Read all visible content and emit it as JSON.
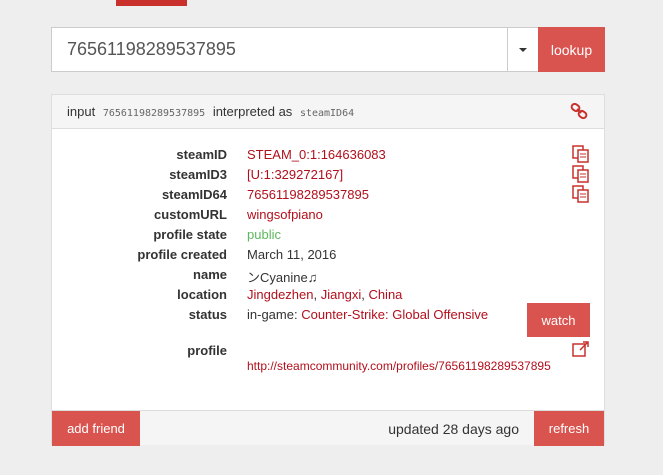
{
  "search": {
    "value": "76561198289537895",
    "lookup_label": "lookup"
  },
  "heading": {
    "prefix": "input",
    "input_value": "76561198289537895",
    "middle": "interpreted as",
    "interpreted_as": "steamID64"
  },
  "rows": [
    {
      "label": "steamID",
      "value": "STEAM_0:1:164636083"
    },
    {
      "label": "steamID3",
      "value": "[U:1:329272167]"
    },
    {
      "label": "steamID64",
      "value": "76561198289537895"
    },
    {
      "label": "customURL",
      "value": "wingsofpiano"
    },
    {
      "label": "profile state",
      "value": "public"
    },
    {
      "label": "profile created",
      "value": "March 11, 2016"
    },
    {
      "label": "name",
      "value": "ンCyanine♫"
    },
    {
      "label": "location",
      "city": "Jingdezhen",
      "region": "Jiangxi",
      "country": "China"
    },
    {
      "label": "status",
      "prefix": "in-game:",
      "game": "Counter-Strike: Global Offensive"
    },
    {
      "label": "profile",
      "url": "http://steamcommunity.com/profiles/76561198289537895"
    }
  ],
  "watch_label": "watch",
  "footer": {
    "add_friend_label": "add friend",
    "updated_text": "updated 28 days ago",
    "refresh_label": "refresh"
  },
  "colors": {
    "accent": "#d9534f",
    "link": "#b20f1c",
    "public": "#5cb85c"
  },
  "icons": {
    "dropdown": "caret-down-icon",
    "heading_link": "link-icon",
    "copy": "copy-icon",
    "external": "external-link-icon"
  }
}
